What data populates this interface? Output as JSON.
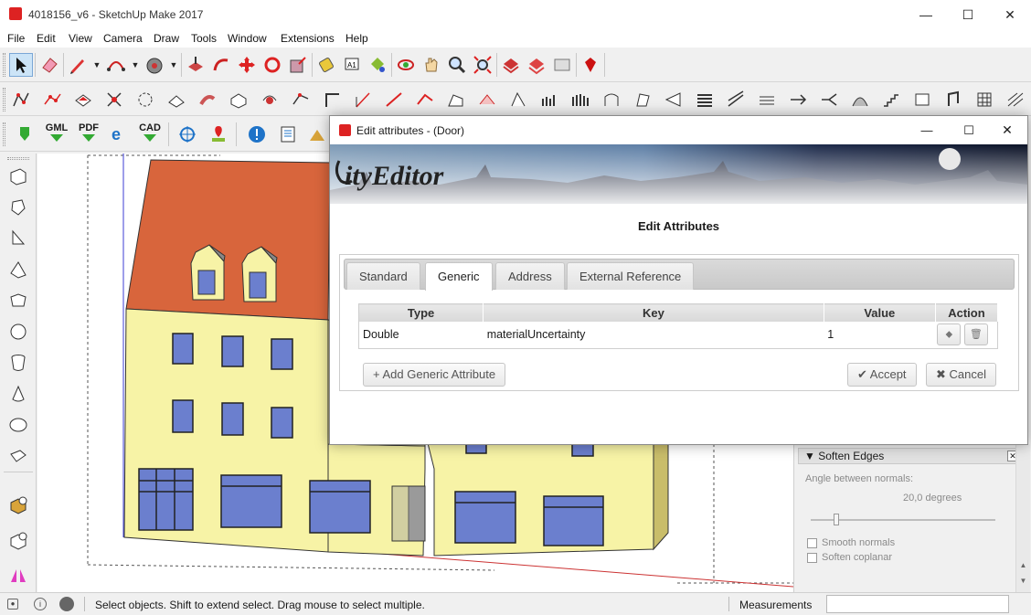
{
  "window": {
    "title": "4018156_v6 - SketchUp Make 2017",
    "minimize": "—",
    "maximize": "☐",
    "close": "✕"
  },
  "menu": [
    "File",
    "Edit",
    "View",
    "Camera",
    "Draw",
    "Tools",
    "Window",
    "Extensions",
    "Help"
  ],
  "toolbar3_labels": {
    "gml": "GML",
    "pdf": "PDF",
    "cad": "CAD"
  },
  "dialog": {
    "title": "Edit attributes -  (Door)",
    "banner_brand": "ityEditor",
    "heading": "Edit Attributes",
    "tabs": [
      "Standard",
      "Generic",
      "Address",
      "External Reference"
    ],
    "active_tab": "Generic",
    "table": {
      "headers": [
        "Type",
        "Key",
        "Value",
        "Action"
      ],
      "rows": [
        {
          "type": "Double",
          "key": "materialUncertainty",
          "value": "1"
        }
      ]
    },
    "add_button": "+ Add Generic Attribute",
    "accept_button": "✔ Accept",
    "cancel_button": "✖ Cancel"
  },
  "tray": {
    "title": "Soften Edges",
    "angle_label": "Angle between normals:",
    "angle_value": "20,0  degrees",
    "smooth_normals": "Smooth normals",
    "soften_coplanar": "Soften coplanar"
  },
  "status": {
    "hint": "Select objects. Shift to extend select. Drag mouse to select multiple.",
    "measurements_label": "Measurements"
  },
  "colors": {
    "wall": "#f7f3a6",
    "roof": "#d8653c",
    "window": "#6b7fce",
    "accent_red": "#d22222"
  }
}
